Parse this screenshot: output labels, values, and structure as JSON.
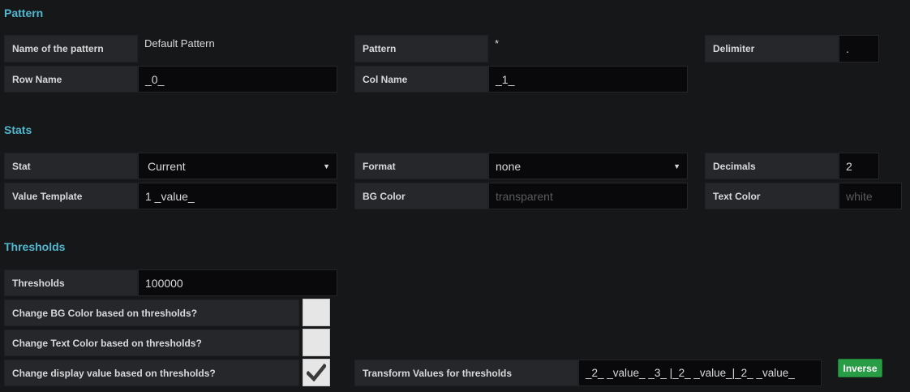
{
  "sections": {
    "pattern": "Pattern",
    "stats": "Stats",
    "thresholds": "Thresholds"
  },
  "pattern": {
    "name_label": "Name of the pattern",
    "name_value": "Default Pattern",
    "pattern_label": "Pattern",
    "pattern_value": "*",
    "delimiter_label": "Delimiter",
    "delimiter_value": ".",
    "row_name_label": "Row Name",
    "row_name_value": "_0_",
    "col_name_label": "Col Name",
    "col_name_value": "_1_"
  },
  "stats": {
    "stat_label": "Stat",
    "stat_value": "Current",
    "format_label": "Format",
    "format_value": "none",
    "decimals_label": "Decimals",
    "decimals_value": "2",
    "value_template_label": "Value Template",
    "value_template_value": "1 _value_",
    "bg_color_label": "BG Color",
    "bg_color_placeholder": "transparent",
    "text_color_label": "Text Color",
    "text_color_placeholder": "white"
  },
  "thresholds": {
    "thresholds_label": "Thresholds",
    "thresholds_value": "100000",
    "change_bg_label": "Change BG Color based on thresholds?",
    "change_bg_checked": false,
    "change_text_label": "Change Text Color based on thresholds?",
    "change_text_checked": false,
    "change_display_label": "Change display value based on thresholds?",
    "change_display_checked": true,
    "transform_label": "Transform Values for thresholds",
    "transform_value": "_2_ _value_ _3_ |_2_ _value_|_2_ _value_",
    "inverse_button": "Inverse"
  },
  "icons": {
    "select_caret": "caret-down-icon",
    "checkmark": "checkmark-icon"
  },
  "colors": {
    "section_title": "#52b8d0",
    "inverse_button": "#299c46"
  }
}
